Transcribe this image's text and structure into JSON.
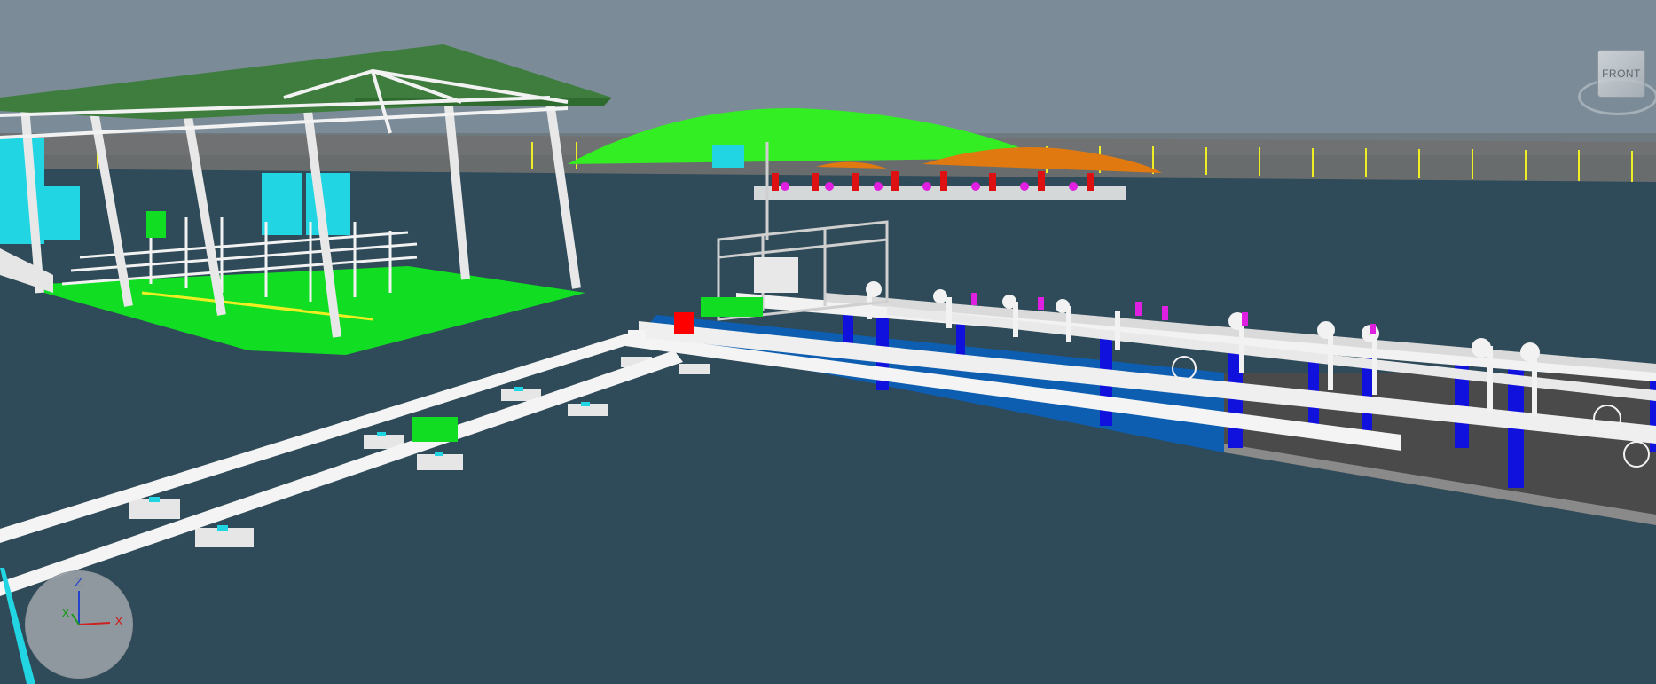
{
  "viewport": {
    "name": "3d-plant-model-view",
    "background": "#2f4a58",
    "sky_color": "#7b8b98"
  },
  "viewcube": {
    "face_label": "FRONT"
  },
  "triad": {
    "z_label": "Z",
    "x_label": "X",
    "y_label": "X"
  },
  "colors": {
    "canopy_roof": "#3e7d3e",
    "structure_white": "#f2f2f2",
    "equipment_cyan": "#21d6e2",
    "slab_green": "#11dd22",
    "steel_blue": "#1111dd",
    "deck_blue": "#0d5eb0",
    "deck_grey": "#4a4a4a",
    "valve_magenta": "#e020e0",
    "valve_red": "#dd1111",
    "hill_green": "#33ee22",
    "orange_mound": "#e07a10",
    "fence_posts": "#eeee22"
  }
}
